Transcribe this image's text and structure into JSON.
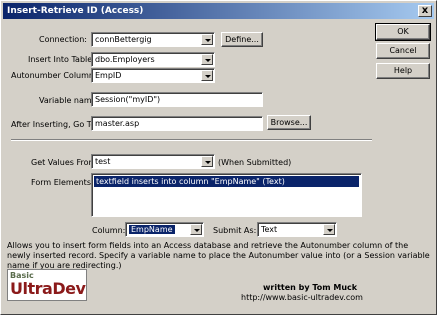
{
  "window": {
    "title": "Insert-Retrieve ID (Access)",
    "close_glyph": "x"
  },
  "buttons": {
    "ok": "OK",
    "cancel": "Cancel",
    "help": "Help",
    "define": "Define...",
    "browse": "Browse..."
  },
  "form": {
    "connection": {
      "label": "Connection:",
      "value": "connBettergig"
    },
    "insert_into_table": {
      "label": "Insert Into Table:",
      "value": "dbo.Employers"
    },
    "autonumber_column": {
      "label": "Autonumber Column:",
      "value": "EmpID"
    },
    "variable_name": {
      "label": "Variable name:",
      "value": "Session(\"myID\")"
    },
    "after_inserting": {
      "label": "After Inserting, Go To:",
      "value": "master.asp"
    },
    "get_values_from": {
      "label": "Get Values From:",
      "value": "test",
      "note": "(When Submitted)"
    },
    "form_elements": {
      "label": "Form Elements:",
      "items": [
        "textfield inserts into column \"EmpName\" (Text)"
      ]
    },
    "column": {
      "label": "Column:",
      "value": "EmpName"
    },
    "submit_as": {
      "label": "Submit As:",
      "value": "Text"
    }
  },
  "description": "Allows you to insert form fields into an Access database and retrieve the Autonumber column of the newly inserted record. Specify a variable name to place the Autonumber value into (or a Session variable name if you are redirecting.)",
  "footer": {
    "logo_top": "Basic",
    "logo_main": "UltraDev",
    "author": "written by Tom Muck",
    "url": "http://www.basic-ultradev.com"
  }
}
